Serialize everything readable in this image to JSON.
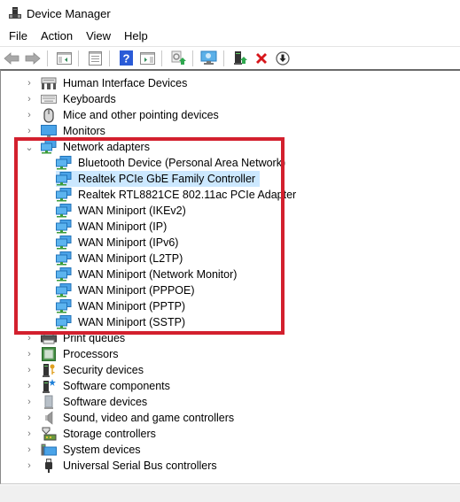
{
  "window": {
    "title": "Device Manager",
    "icon": "device-manager-icon"
  },
  "menu": [
    {
      "label": "File"
    },
    {
      "label": "Action"
    },
    {
      "label": "View"
    },
    {
      "label": "Help"
    }
  ],
  "toolbar": {
    "buttons": [
      {
        "name": "back-button",
        "icon": "back-arrow-icon",
        "enabled": false
      },
      {
        "name": "forward-button",
        "icon": "forward-arrow-icon",
        "enabled": false
      },
      {
        "name": "show-hide-console-tree-button",
        "icon": "console-tree-icon"
      },
      {
        "name": "properties-button",
        "icon": "properties-icon"
      },
      {
        "name": "help-button",
        "icon": "help-icon"
      },
      {
        "name": "show-hide-action-pane-button",
        "icon": "action-pane-icon"
      },
      {
        "name": "update-driver-button",
        "icon": "update-driver-icon"
      },
      {
        "name": "scan-hardware-changes-button",
        "icon": "scan-hardware-icon"
      },
      {
        "name": "enable-device-button",
        "icon": "enable-device-icon"
      },
      {
        "name": "uninstall-device-button",
        "icon": "uninstall-x-icon"
      },
      {
        "name": "disable-device-button",
        "icon": "disable-device-icon"
      }
    ]
  },
  "tree": {
    "categories_before": [
      {
        "label": "Human Interface Devices",
        "icon": "hid-icon",
        "expanded": false
      },
      {
        "label": "Keyboards",
        "icon": "keyboard-icon",
        "expanded": false
      },
      {
        "label": "Mice and other pointing devices",
        "icon": "mouse-icon",
        "expanded": false
      },
      {
        "label": "Monitors",
        "icon": "monitor-icon",
        "expanded": false
      }
    ],
    "network": {
      "label": "Network adapters",
      "icon": "network-adapter-icon",
      "expanded": true,
      "children": [
        {
          "label": "Bluetooth Device (Personal Area Network)",
          "selected": false
        },
        {
          "label": "Realtek PCIe GbE Family Controller",
          "selected": true
        },
        {
          "label": "Realtek RTL8821CE 802.11ac PCIe Adapter",
          "selected": false
        },
        {
          "label": "WAN Miniport (IKEv2)",
          "selected": false
        },
        {
          "label": "WAN Miniport (IP)",
          "selected": false
        },
        {
          "label": "WAN Miniport (IPv6)",
          "selected": false
        },
        {
          "label": "WAN Miniport (L2TP)",
          "selected": false
        },
        {
          "label": "WAN Miniport (Network Monitor)",
          "selected": false
        },
        {
          "label": "WAN Miniport (PPPOE)",
          "selected": false
        },
        {
          "label": "WAN Miniport (PPTP)",
          "selected": false
        },
        {
          "label": "WAN Miniport (SSTP)",
          "selected": false
        }
      ]
    },
    "categories_after": [
      {
        "label": "Print queues",
        "icon": "printer-icon",
        "expanded": false
      },
      {
        "label": "Processors",
        "icon": "processor-icon",
        "expanded": false
      },
      {
        "label": "Security devices",
        "icon": "security-device-icon",
        "expanded": false
      },
      {
        "label": "Software components",
        "icon": "software-component-icon",
        "expanded": false
      },
      {
        "label": "Software devices",
        "icon": "software-device-icon",
        "expanded": false
      },
      {
        "label": "Sound, video and game controllers",
        "icon": "speaker-icon",
        "expanded": false
      },
      {
        "label": "Storage controllers",
        "icon": "storage-controller-icon",
        "expanded": false
      },
      {
        "label": "System devices",
        "icon": "system-devices-icon",
        "expanded": false
      },
      {
        "label": "Universal Serial Bus controllers",
        "icon": "usb-icon",
        "expanded": false
      }
    ]
  },
  "annotation": {
    "highlight_color": "#d3202e",
    "target": "Network adapters"
  },
  "colors": {
    "selection": "#cce8ff",
    "highlight": "#d3202e"
  }
}
